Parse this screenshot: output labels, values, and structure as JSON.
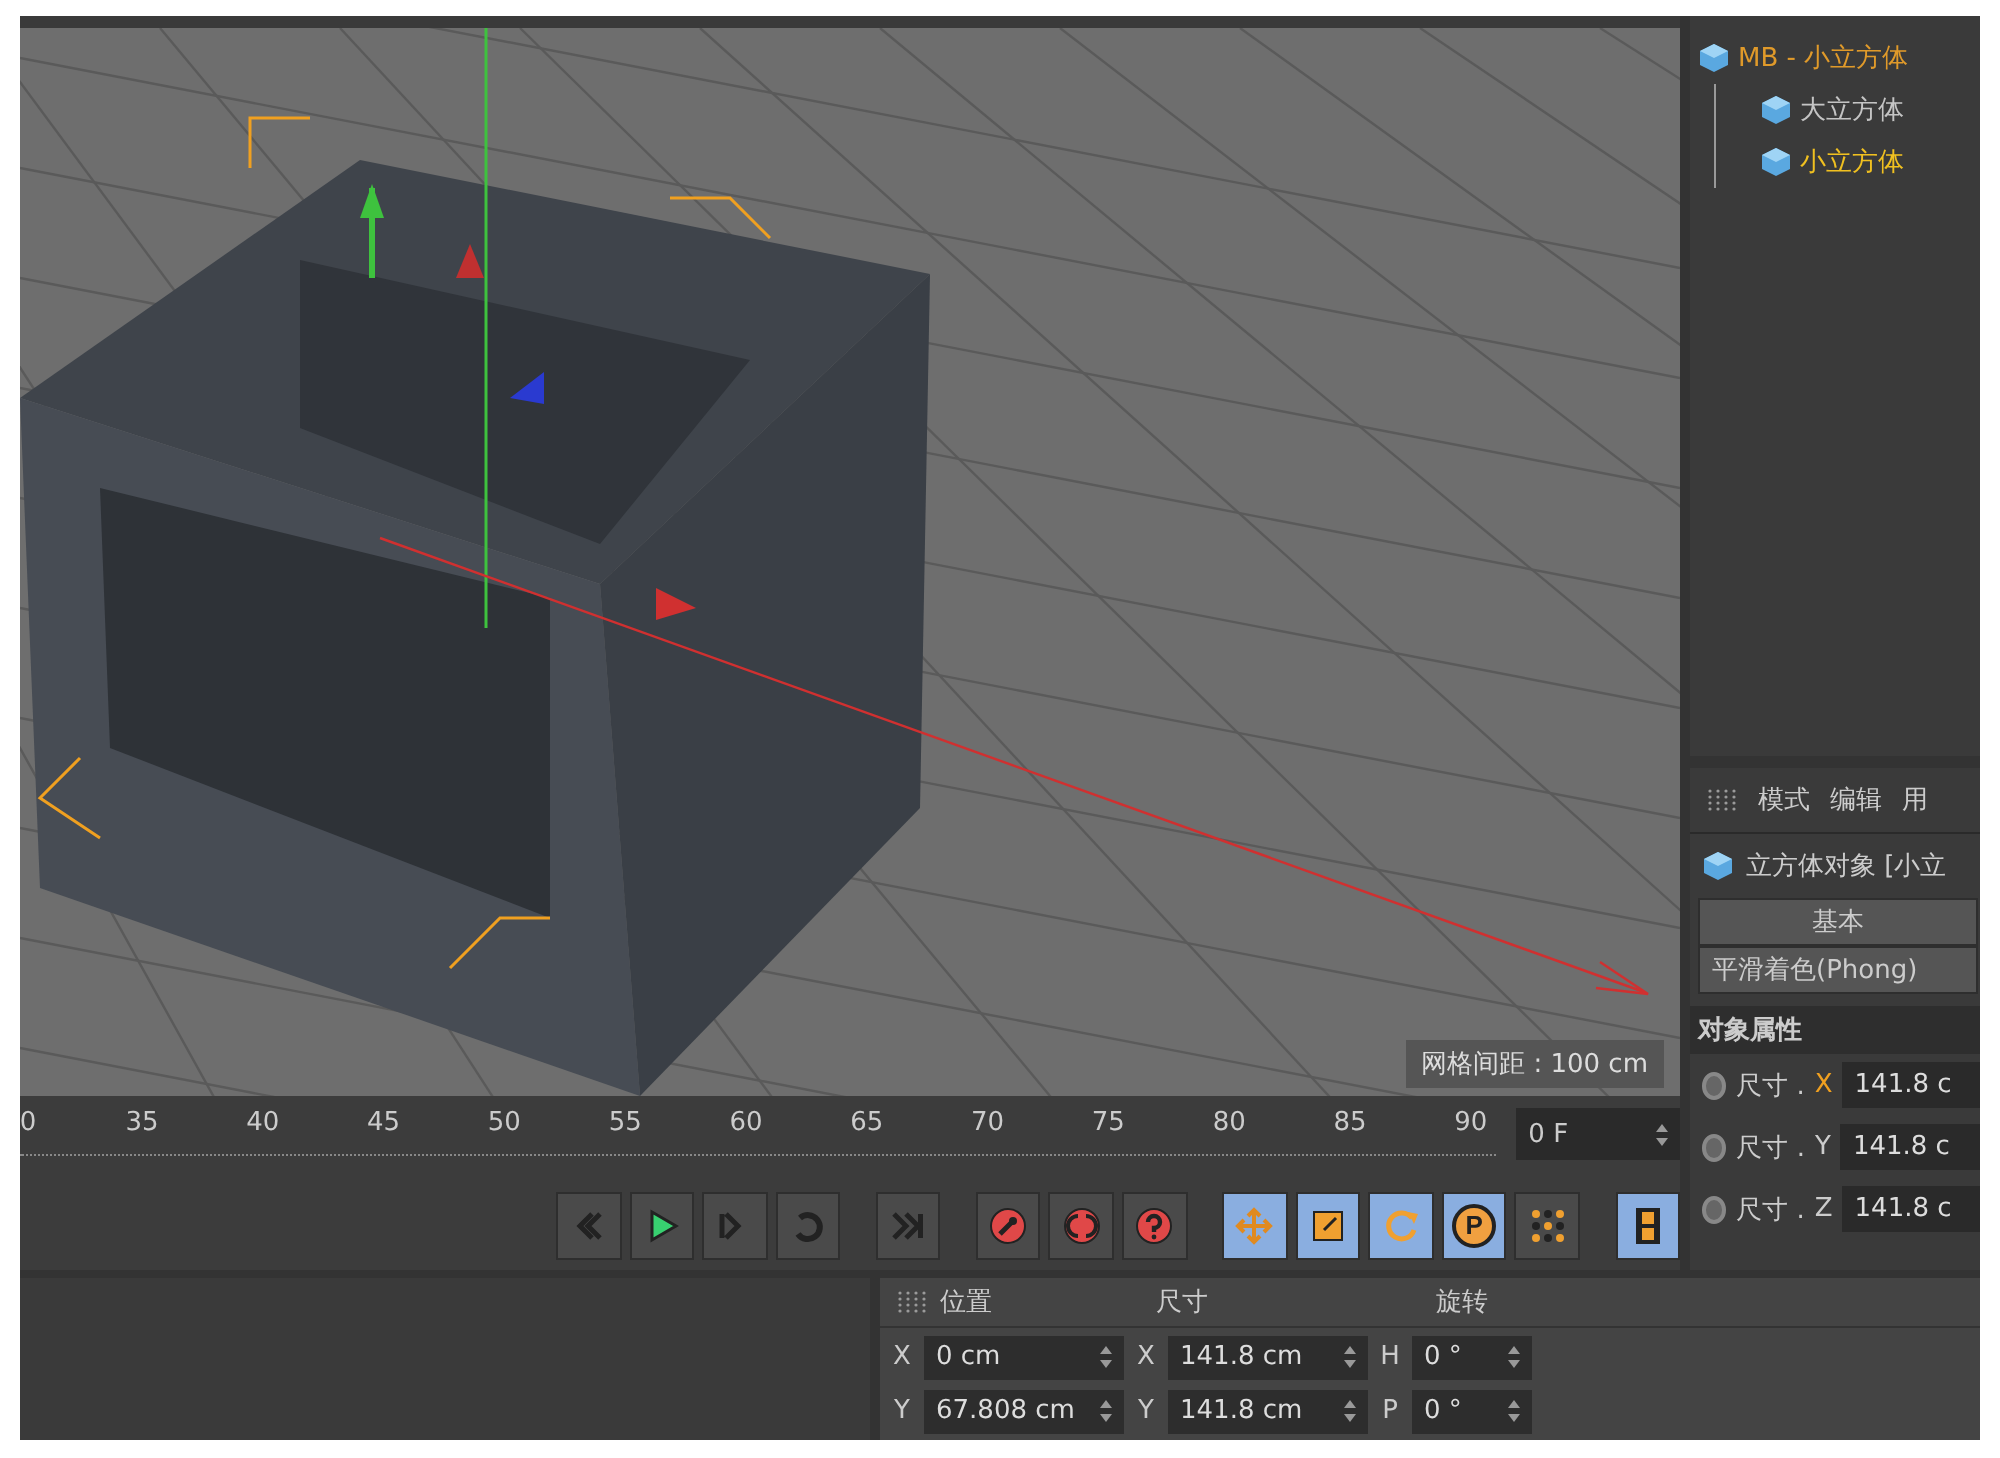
{
  "viewport": {
    "grid_spacing": "网格间距 : 100 cm"
  },
  "timeline": {
    "ticks": [
      "0",
      "35",
      "40",
      "45",
      "50",
      "55",
      "60",
      "65",
      "70",
      "75",
      "80",
      "85",
      "90"
    ],
    "current_frame": "0 F"
  },
  "tools": {
    "points_label": "P"
  },
  "object_manager": {
    "items": [
      {
        "label": "MB - 小立方体",
        "color": "#e09a2a",
        "children": [
          {
            "label": "大立方体",
            "color": "#c4c4c4"
          },
          {
            "label": "小立方体",
            "color": "#f0c020"
          }
        ]
      }
    ]
  },
  "attributes": {
    "menu": [
      "模式",
      "编辑",
      "用"
    ],
    "object_title": "立方体对象 [小立",
    "tabs": [
      "基本",
      "平滑着色(Phong)"
    ],
    "section": "对象属性",
    "fields": [
      {
        "label": "尺寸 .",
        "axis": "X",
        "highlighted": true,
        "keyframed": false,
        "value": "141.8 c"
      },
      {
        "label": "尺寸 .",
        "axis": "Y",
        "highlighted": false,
        "keyframed": false,
        "value": "141.8 c"
      },
      {
        "label": "尺寸 .",
        "axis": "Z",
        "highlighted": false,
        "keyframed": false,
        "value": "141.8 c"
      }
    ]
  },
  "coordinates": {
    "columns": [
      "位置",
      "尺寸",
      "旋转"
    ],
    "rows": [
      {
        "cells": [
          {
            "axis": "X",
            "value": "0 cm"
          },
          {
            "axis": "X",
            "value": "141.8 cm"
          },
          {
            "axis": "H",
            "value": "0 °"
          }
        ]
      },
      {
        "cells": [
          {
            "axis": "Y",
            "value": "67.808 cm"
          },
          {
            "axis": "Y",
            "value": "141.8 cm"
          },
          {
            "axis": "P",
            "value": "0 °"
          }
        ]
      }
    ]
  }
}
